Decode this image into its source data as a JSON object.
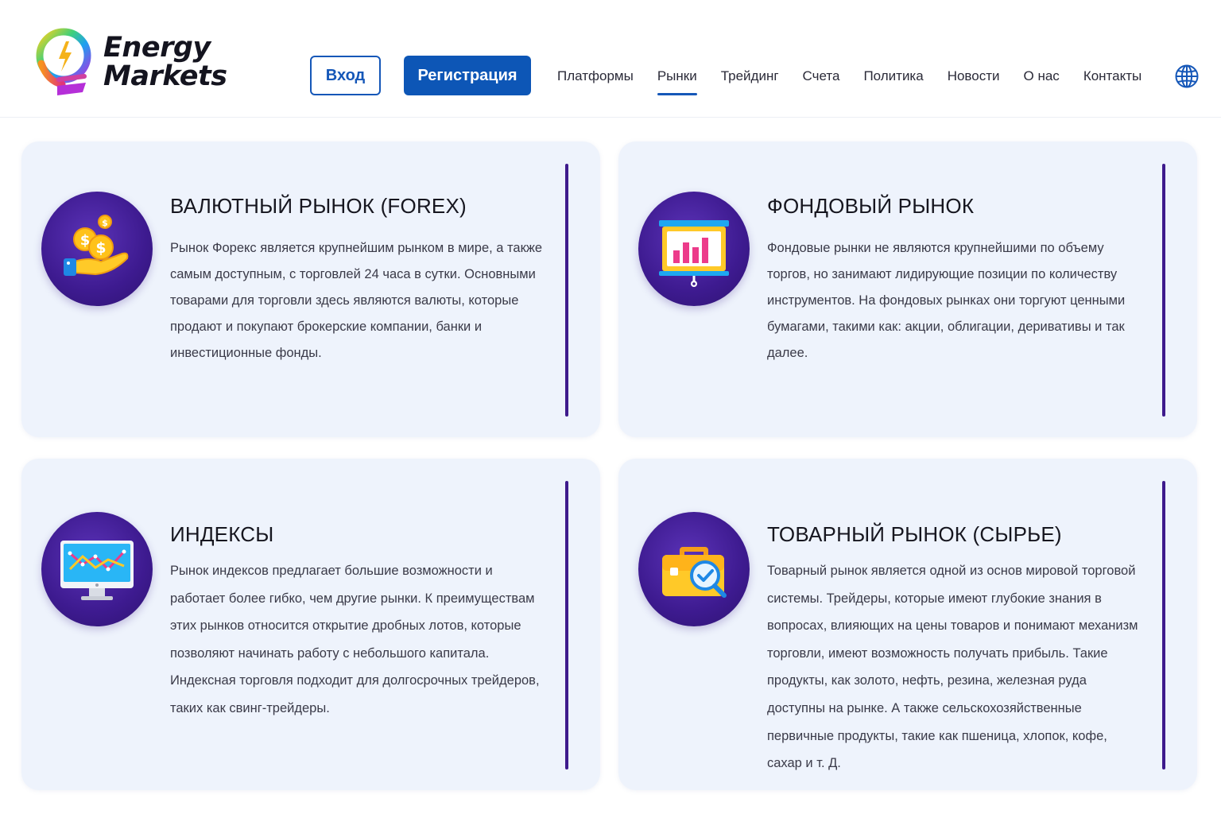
{
  "brand": {
    "line1": "Energy",
    "line2": "Markets"
  },
  "header": {
    "login_label": "Вход",
    "register_label": "Регистрация",
    "nav": [
      {
        "label": "Платформы",
        "active": false
      },
      {
        "label": "Рынки",
        "active": true
      },
      {
        "label": "Трейдинг",
        "active": false
      },
      {
        "label": "Счета",
        "active": false
      },
      {
        "label": "Политика",
        "active": false
      },
      {
        "label": "Новости",
        "active": false
      },
      {
        "label": "О нас",
        "active": false
      },
      {
        "label": "Контакты",
        "active": false
      }
    ],
    "globe_icon": "globe-icon"
  },
  "colors": {
    "primary_blue": "#0d56b6",
    "accent_purple": "#3e1a8c",
    "card_bg": "#eef3fc"
  },
  "cards": [
    {
      "icon": "coins-hand-icon",
      "title": "ВАЛЮТНЫЙ РЫНОК (FOREX)",
      "text": "Рынок Форекс является крупнейшим рынком в мире, а также самым доступным, с торговлей 24 часа в сутки. Основными товарами для торговли здесь являются валюты, которые продают и покупают брокерские компании, банки и инвестиционные фонды."
    },
    {
      "icon": "presentation-chart-icon",
      "title": "ФОНДОВЫЙ РЫНОК",
      "text": "Фондовые рынки не являются крупнейшими по объему торгов, но занимают лидирующие позиции по количеству инструментов. На фондовых рынках они торгуют ценными бумагами, такими как: акции, облигации, деривативы и так далее."
    },
    {
      "icon": "monitor-graph-icon",
      "title": "ИНДЕКСЫ",
      "text": "Рынок индексов предлагает большие возможности и работает более гибко, чем другие рынки. К преимуществам этих рынков относится открытие дробных лотов, которые позволяют начинать работу с небольшого капитала. Индексная торговля подходит для долгосрочных трейдеров, таких как свинг-трейдеры."
    },
    {
      "icon": "briefcase-search-icon",
      "title": "ТОВАРНЫЙ РЫНОК (СЫРЬЕ)",
      "text": "Товарный рынок является одной из основ мировой торговой системы. Трейдеры, которые имеют глубокие знания в вопросах, влияющих на цены товаров и понимают механизм торговли, имеют возможность получать прибыль. Такие продукты, как золото, нефть, резина, железная руда доступны на рынке. А также сельскохозяйственные первичные продукты, такие как пшеница, хлопок, кофе, сахар и т. Д."
    }
  ]
}
